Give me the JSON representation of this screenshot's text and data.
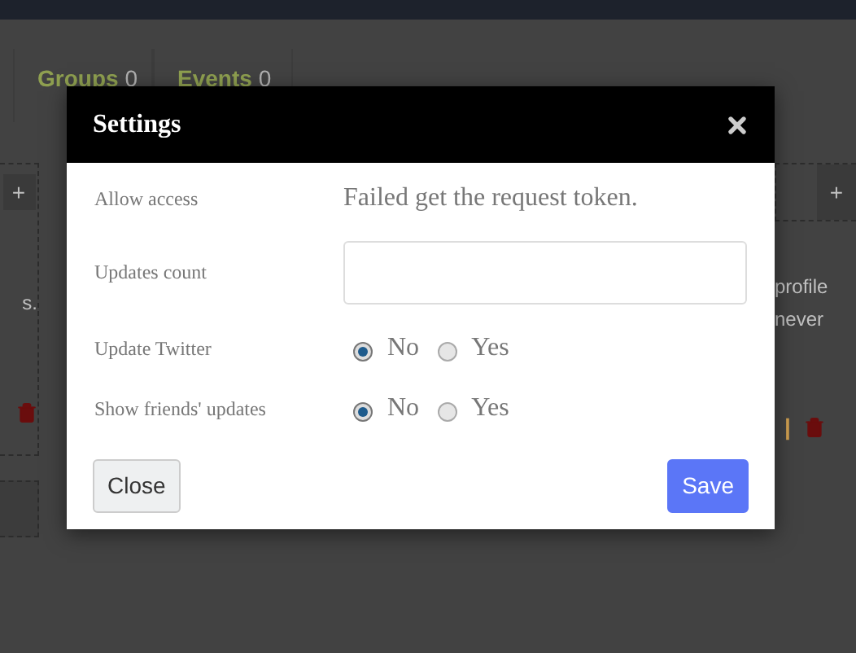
{
  "background": {
    "tabs": [
      {
        "label": "Groups",
        "count": "0"
      },
      {
        "label": "Events",
        "count": "0"
      }
    ],
    "left_panel": {
      "add": "+",
      "text": "s."
    },
    "right_panel": {
      "add": "+",
      "lines": [
        "profile",
        "never"
      ],
      "separator": "|"
    }
  },
  "dialog": {
    "title": "Settings",
    "rows": [
      {
        "kind": "message",
        "label": "Allow access",
        "text": "Failed get the request token."
      },
      {
        "kind": "input",
        "label": "Updates count"
      },
      {
        "kind": "radio",
        "label": "Update Twitter",
        "options": [
          {
            "label": "No",
            "selected": true
          },
          {
            "label": "Yes",
            "selected": false
          }
        ]
      },
      {
        "kind": "radio",
        "label": "Show friends' updates",
        "options": [
          {
            "label": "No",
            "selected": true
          },
          {
            "label": "Yes",
            "selected": false
          }
        ]
      }
    ],
    "buttons": [
      {
        "kind": "secondary",
        "label": "Close"
      },
      {
        "kind": "primary",
        "label": "Save"
      }
    ]
  }
}
